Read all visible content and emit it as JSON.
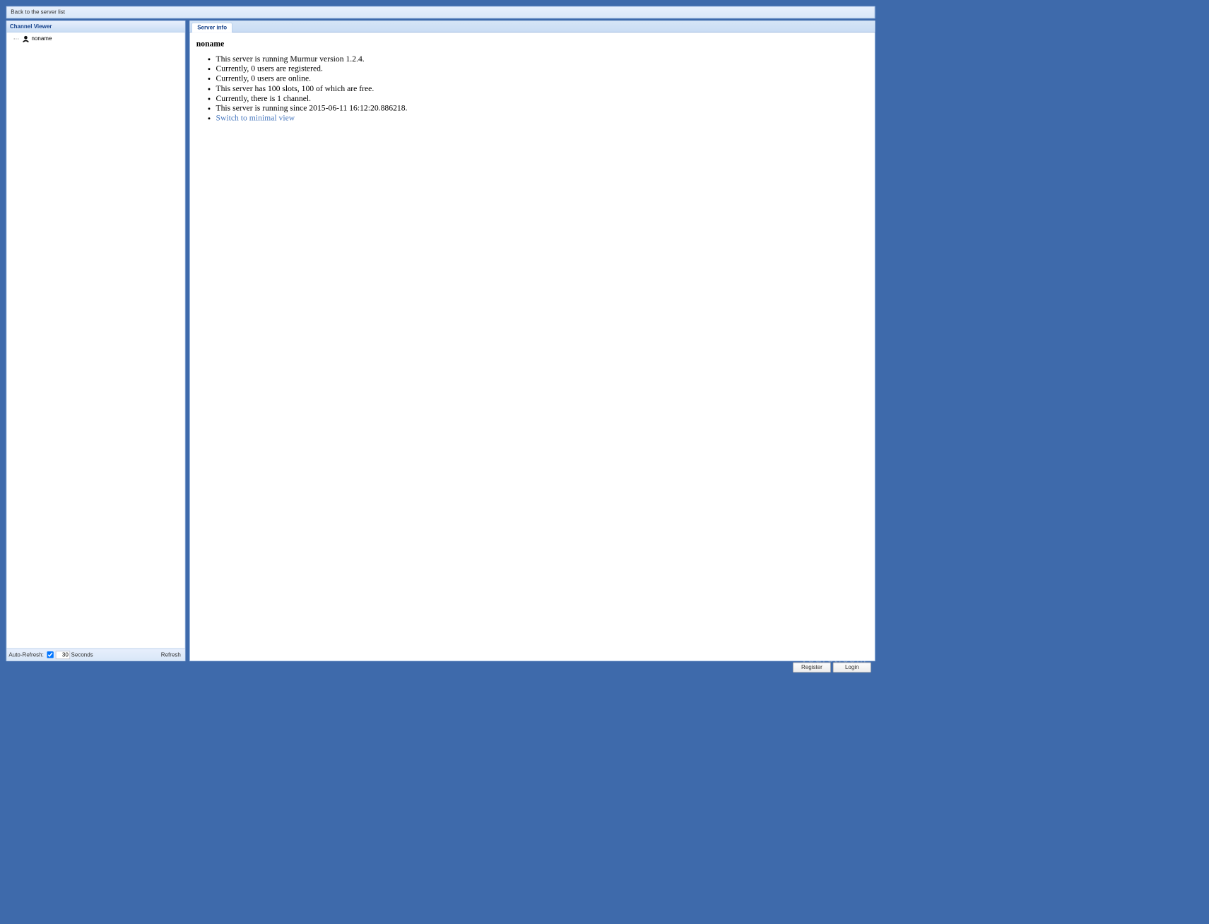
{
  "top_bar": {
    "back_link": "Back to the server list"
  },
  "sidebar": {
    "title": "Channel Viewer",
    "root_item": "noname",
    "footer": {
      "auto_refresh_label": "Auto-Refresh:",
      "auto_refresh_checked": true,
      "interval_value": "30",
      "interval_unit": "Seconds",
      "refresh_label": "Refresh"
    }
  },
  "main": {
    "tab_label": "Server info",
    "heading": "noname",
    "info_items": [
      "This server is running Murmur version 1.2.4.",
      "Currently, 0 users are registered.",
      "Currently, 0 users are online.",
      "This server has 100 slots, 100 of which are free.",
      "Currently, there is 1 channel.",
      "This server is running since 2015-06-11 16:12:20.886218."
    ],
    "link_text": "Switch to minimal view"
  },
  "footer": {
    "register": "Register",
    "login": "Login"
  },
  "watermark": "yourct.com"
}
